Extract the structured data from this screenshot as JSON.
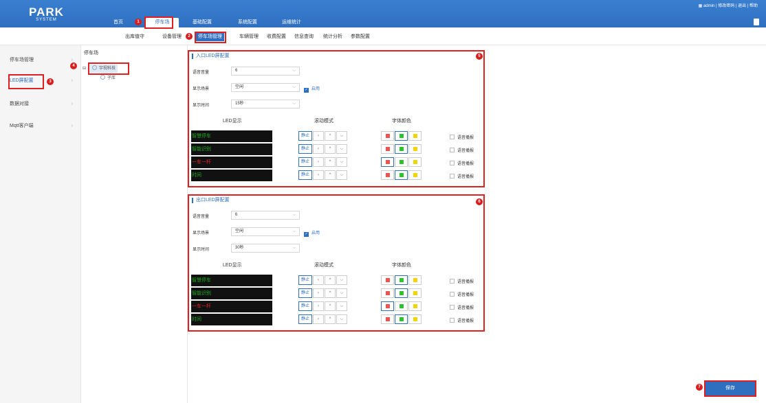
{
  "header": {
    "logo_line1": "PARK",
    "logo_line2": "SYSTEM",
    "nav": [
      "首页",
      "停车场",
      "基础配置",
      "系统配置",
      "运维统计"
    ],
    "user_links": "admin | 修改密码 | 退出 | 帮助"
  },
  "subnav": [
    "出库值守",
    "设备管理",
    "停车场管理",
    "车辆管理",
    "收费配置",
    "信息查询",
    "统计分析",
    "参数配置"
  ],
  "sidebar": [
    "停车场管理",
    "LED屏配置",
    "数据对接",
    "Mqtt客户端"
  ],
  "tree": {
    "title": "停车场",
    "root": "宇视科技",
    "child": "子库"
  },
  "entry": {
    "title": "入口LED屏配置",
    "volume_label": "语音音量",
    "volume_value": "6",
    "scene_label": "显示场景",
    "scene_value": "空闲",
    "enable_label": "启用",
    "time_label": "显示时间",
    "time_value": "15秒",
    "col_led": "LED显示",
    "col_scroll": "滚动模式",
    "col_color": "字体颜色",
    "rows": [
      "智慧停车",
      "智能识别",
      "一车一杆",
      "时间"
    ]
  },
  "exit": {
    "title": "出口LED屏配置",
    "volume_label": "语音音量",
    "volume_value": "6",
    "scene_label": "显示场景",
    "scene_value": "空闲",
    "enable_label": "启用",
    "time_label": "显示时间",
    "time_value": "30秒",
    "col_led": "LED显示",
    "col_scroll": "滚动模式",
    "col_color": "字体颜色",
    "rows": [
      "智慧停车",
      "智能识别",
      "一车一杆",
      "时间"
    ]
  },
  "scroll_static": "静止",
  "voice_label": "语音播报",
  "save_label": "保存",
  "annotations": [
    "1",
    "2",
    "3",
    "4",
    "5",
    "6",
    "7"
  ],
  "colors": {
    "accent": "#2f6fc0",
    "annotation": "#e02020",
    "led_green": "#22aa22",
    "led_red": "#ee2222"
  }
}
